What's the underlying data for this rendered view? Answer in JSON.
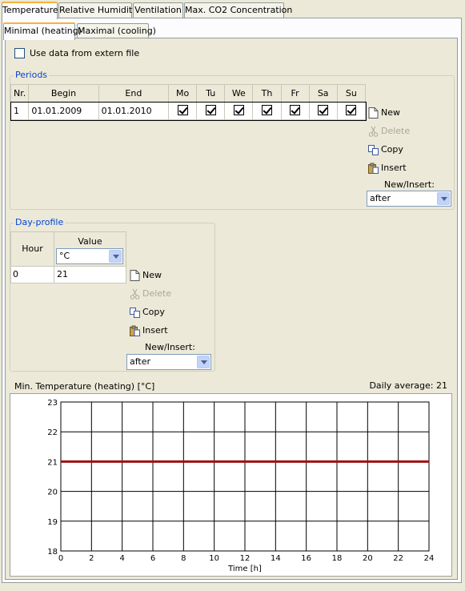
{
  "top_tabs": [
    "Temperature",
    "Relative Humidity",
    "Ventilation",
    "Max. CO2 Concentration"
  ],
  "sub_tabs": [
    "Minimal (heating)",
    "Maximal (cooling)"
  ],
  "extern_file": {
    "label": "Use data from extern file",
    "checked": false
  },
  "periods": {
    "title": "Periods",
    "columns": [
      "Nr.",
      "Begin",
      "End",
      "Mo",
      "Tu",
      "We",
      "Th",
      "Fr",
      "Sa",
      "Su"
    ],
    "rows": [
      {
        "nr": "1",
        "begin": "01.01.2009",
        "end": "01.01.2010",
        "days": [
          true,
          true,
          true,
          true,
          true,
          true,
          true
        ]
      }
    ],
    "buttons": {
      "new": "New",
      "delete": "Delete",
      "copy": "Copy",
      "insert": "Insert"
    },
    "new_insert_label": "New/Insert:",
    "new_insert_value": "after"
  },
  "day_profile": {
    "title": "Day-profile",
    "columns": {
      "hour": "Hour",
      "value": "Value"
    },
    "unit": "°C",
    "rows": [
      {
        "hour": "0",
        "value": "21"
      }
    ],
    "buttons": {
      "new": "New",
      "delete": "Delete",
      "copy": "Copy",
      "insert": "Insert"
    },
    "new_insert_label": "New/Insert:",
    "new_insert_value": "after"
  },
  "chart_header": {
    "title": "Min. Temperature (heating) [°C]",
    "daily_average": "Daily average: 21"
  },
  "chart_data": {
    "type": "line",
    "title": "Min. Temperature (heating) [°C]",
    "xlabel": "Time [h]",
    "ylabel": "",
    "xlim": [
      0,
      24
    ],
    "ylim": [
      18,
      23
    ],
    "xticks": [
      0,
      2,
      4,
      6,
      8,
      10,
      12,
      14,
      16,
      18,
      20,
      22,
      24
    ],
    "yticks": [
      18,
      19,
      20,
      21,
      22,
      23
    ],
    "grid": true,
    "series": [
      {
        "x": [
          0,
          24
        ],
        "y": [
          21,
          21
        ],
        "color": "#a01010"
      }
    ]
  }
}
